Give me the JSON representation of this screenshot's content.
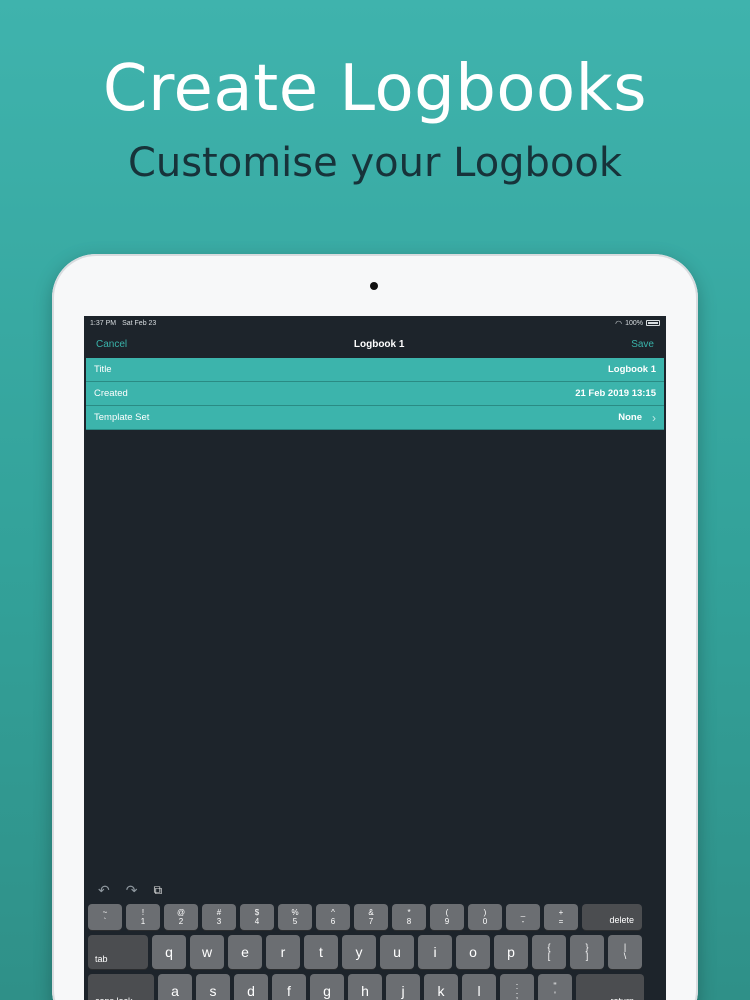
{
  "headline": "Create Logbooks",
  "subhead": "Customise your Logbook",
  "status": {
    "time": "1:37 PM",
    "date": "Sat Feb 23",
    "battery": "100%"
  },
  "nav": {
    "cancel": "Cancel",
    "title": "Logbook 1",
    "save": "Save"
  },
  "rows": [
    {
      "label": "Title",
      "value": "Logbook 1"
    },
    {
      "label": "Created",
      "value": "21 Feb 2019 13:15"
    },
    {
      "label": "Template Set",
      "value": "None",
      "chevron": "›"
    }
  ],
  "toolbar": {
    "undo": "↶",
    "redo": "↷",
    "paste": "⧉"
  },
  "keyboard": {
    "row1": [
      {
        "top": "~",
        "bottom": "`"
      },
      {
        "top": "!",
        "bottom": "1"
      },
      {
        "top": "@",
        "bottom": "2"
      },
      {
        "top": "#",
        "bottom": "3"
      },
      {
        "top": "$",
        "bottom": "4"
      },
      {
        "top": "%",
        "bottom": "5"
      },
      {
        "top": "^",
        "bottom": "6"
      },
      {
        "top": "&",
        "bottom": "7"
      },
      {
        "top": "*",
        "bottom": "8"
      },
      {
        "top": "(",
        "bottom": "9"
      },
      {
        "top": ")",
        "bottom": "0"
      },
      {
        "top": "_",
        "bottom": "-"
      },
      {
        "top": "+",
        "bottom": "="
      }
    ],
    "delete": "delete",
    "tab": "tab",
    "row2": [
      "q",
      "w",
      "e",
      "r",
      "t",
      "y",
      "u",
      "i",
      "o",
      "p"
    ],
    "row2_syms": [
      {
        "top": "{",
        "bottom": "["
      },
      {
        "top": "}",
        "bottom": "]"
      },
      {
        "top": "|",
        "bottom": "\\"
      }
    ],
    "caps": "caps lock",
    "row3": [
      "a",
      "s",
      "d",
      "f",
      "g",
      "h",
      "j",
      "k",
      "l"
    ],
    "row3_syms": [
      {
        "top": ":",
        "bottom": ";"
      },
      {
        "top": "\"",
        "bottom": "'"
      }
    ],
    "return": "return"
  }
}
